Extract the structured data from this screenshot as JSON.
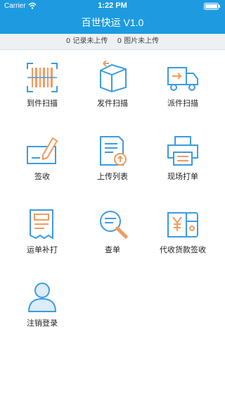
{
  "status_bar": {
    "carrier": "Carrier",
    "time": "1:22 PM"
  },
  "header": {
    "title": "百世快运 V1.0"
  },
  "summary": {
    "records_unuploaded": "0 记录未上传",
    "images_unuploaded": "0 图片未上传"
  },
  "colors": {
    "accent": "#1e9be0",
    "icon_blue": "#3d9ce0",
    "icon_orange": "#f39a5c"
  },
  "menu": [
    {
      "label": "到件扫描",
      "icon": "barcode-scan-icon"
    },
    {
      "label": "发件扫描",
      "icon": "box-send-icon"
    },
    {
      "label": "派件扫描",
      "icon": "delivery-truck-icon"
    },
    {
      "label": "签收",
      "icon": "sign-pen-icon"
    },
    {
      "label": "上传列表",
      "icon": "upload-list-icon"
    },
    {
      "label": "现场打单",
      "icon": "printer-icon"
    },
    {
      "label": "运单补打",
      "icon": "waybill-reprint-icon"
    },
    {
      "label": "查单",
      "icon": "search-order-icon"
    },
    {
      "label": "代收货款签收",
      "icon": "cod-money-icon"
    },
    {
      "label": "注销登录",
      "icon": "logout-user-icon"
    }
  ]
}
